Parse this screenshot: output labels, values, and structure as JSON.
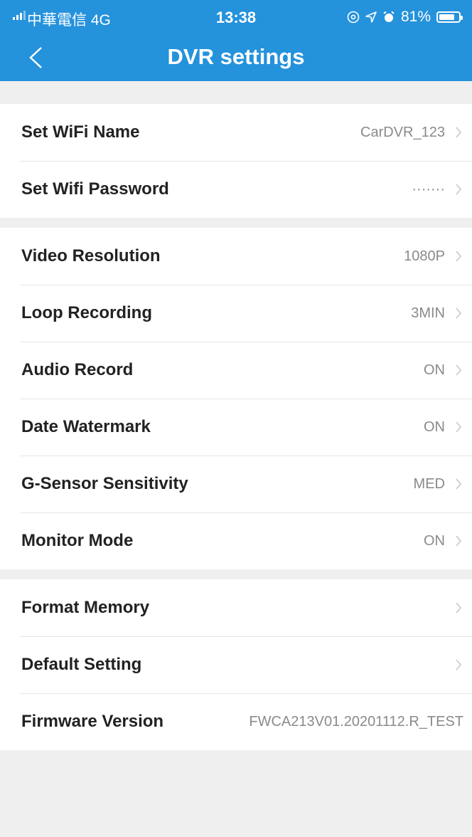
{
  "status_bar": {
    "carrier": "中華電信 4G",
    "time": "13:38",
    "icons": [
      "signal-icon",
      "at-icon",
      "location-icon",
      "alarm-icon",
      "battery-icon"
    ],
    "battery_text": "81%",
    "battery_level": 0.81
  },
  "nav": {
    "title": "DVR settings",
    "back_icon": "chevron-left-icon"
  },
  "groups": [
    {
      "rows": [
        {
          "label": "Set WiFi Name",
          "value": "CarDVR_123"
        },
        {
          "label": "Set Wifi Password",
          "value": "·······"
        }
      ]
    },
    {
      "rows": [
        {
          "label": "Video Resolution",
          "value": "1080P"
        },
        {
          "label": "Loop Recording",
          "value": "3MIN"
        },
        {
          "label": "Audio Record",
          "value": "ON"
        },
        {
          "label": "Date Watermark",
          "value": "ON"
        },
        {
          "label": "G-Sensor Sensitivity",
          "value": "MED"
        },
        {
          "label": "Monitor Mode",
          "value": "ON"
        }
      ]
    },
    {
      "rows": [
        {
          "label": "Format Memory",
          "value": ""
        },
        {
          "label": "Default Setting",
          "value": ""
        },
        {
          "label": "Firmware Version",
          "value": "FWCA213V01.20201112.R_TEST"
        }
      ]
    }
  ],
  "colors": {
    "header": "#2592dc",
    "background": "#efefef",
    "row_background": "#ffffff",
    "value_text": "#8a8a8a"
  }
}
